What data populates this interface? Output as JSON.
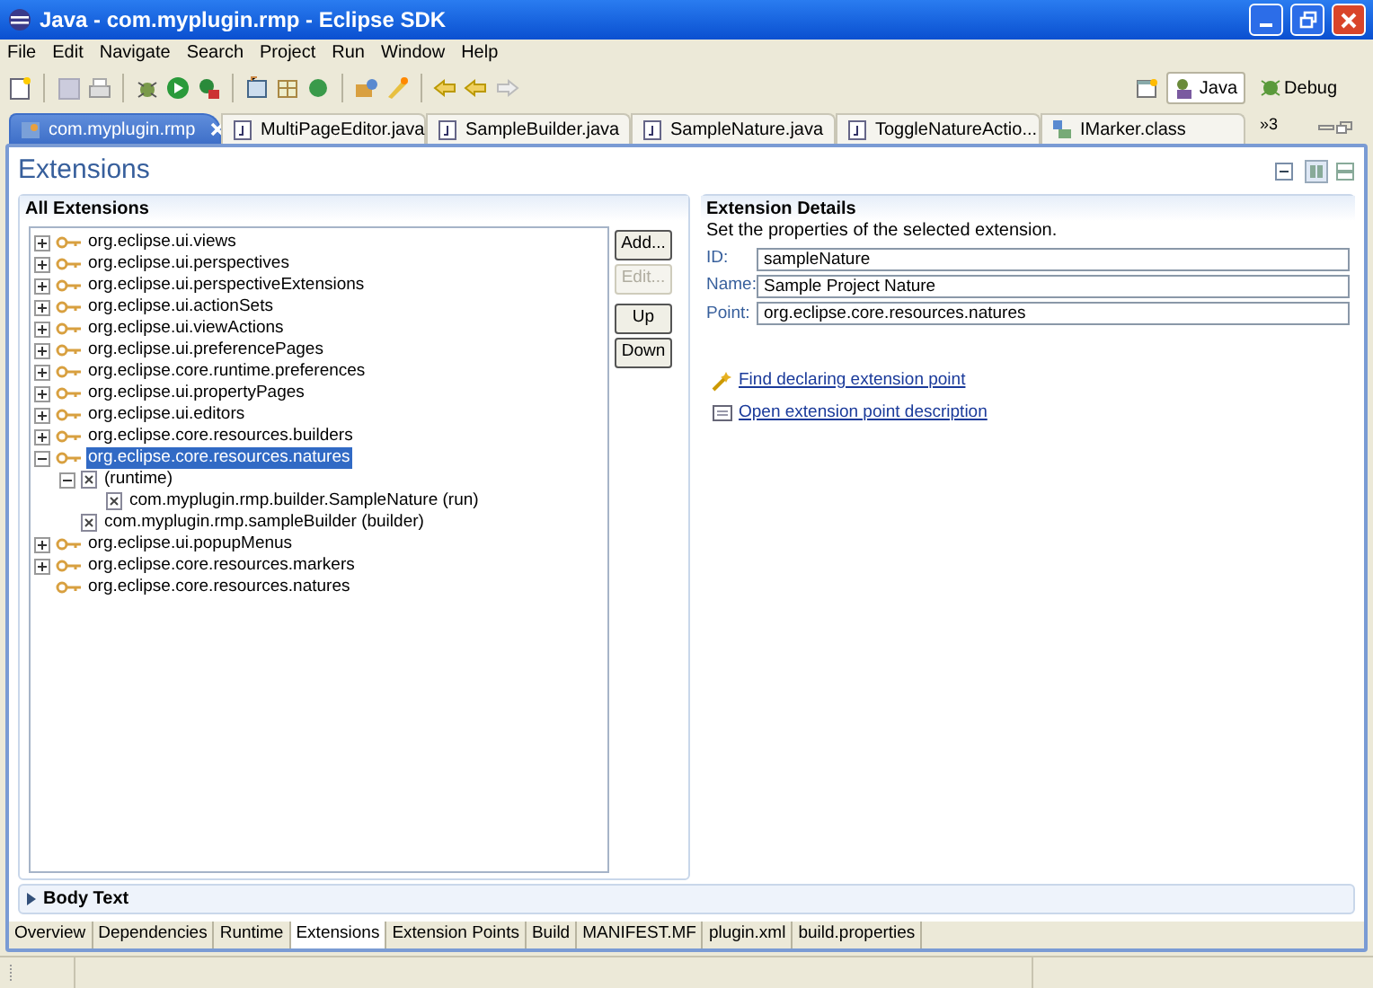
{
  "window": {
    "title": "Java - com.myplugin.rmp - Eclipse SDK"
  },
  "menu": [
    "File",
    "Edit",
    "Navigate",
    "Search",
    "Project",
    "Run",
    "Window",
    "Help"
  ],
  "perspectives": [
    {
      "label": "Java",
      "selected": true
    },
    {
      "label": "Debug",
      "selected": false
    }
  ],
  "editor_tabs": [
    {
      "label": "com.myplugin.rmp",
      "kind": "plugin",
      "selected": true
    },
    {
      "label": "MultiPageEditor.java",
      "kind": "java",
      "selected": false
    },
    {
      "label": "SampleBuilder.java",
      "kind": "java",
      "selected": false
    },
    {
      "label": "SampleNature.java",
      "kind": "java",
      "selected": false
    },
    {
      "label": "ToggleNatureActio...",
      "kind": "java",
      "selected": false
    },
    {
      "label": "IMarker.class",
      "kind": "class",
      "selected": false
    }
  ],
  "overflow_tabs": "»3",
  "page_title": "Extensions",
  "all_extensions": {
    "title": "All Extensions",
    "tree": [
      {
        "label": "org.eclipse.ui.views",
        "kind": "extension",
        "expanded": false,
        "selected": false
      },
      {
        "label": "org.eclipse.ui.perspectives",
        "kind": "extension",
        "expanded": false,
        "selected": false
      },
      {
        "label": "org.eclipse.ui.perspectiveExtensions",
        "kind": "extension",
        "expanded": false,
        "selected": false
      },
      {
        "label": "org.eclipse.ui.actionSets",
        "kind": "extension",
        "expanded": false,
        "selected": false
      },
      {
        "label": "org.eclipse.ui.viewActions",
        "kind": "extension",
        "expanded": false,
        "selected": false
      },
      {
        "label": "org.eclipse.ui.preferencePages",
        "kind": "extension",
        "expanded": false,
        "selected": false
      },
      {
        "label": "org.eclipse.core.runtime.preferences",
        "kind": "extension",
        "expanded": false,
        "selected": false
      },
      {
        "label": "org.eclipse.ui.propertyPages",
        "kind": "extension",
        "expanded": false,
        "selected": false
      },
      {
        "label": "org.eclipse.ui.editors",
        "kind": "extension",
        "expanded": false,
        "selected": false
      },
      {
        "label": "org.eclipse.core.resources.builders",
        "kind": "extension",
        "expanded": false,
        "selected": false
      },
      {
        "label": "org.eclipse.core.resources.natures",
        "kind": "extension",
        "expanded": true,
        "selected": true,
        "children": [
          {
            "label": "(runtime)",
            "kind": "element",
            "expanded": true,
            "selected": false,
            "children": [
              {
                "label": "com.myplugin.rmp.builder.SampleNature (run)",
                "kind": "element",
                "selected": false
              }
            ]
          },
          {
            "label": "com.myplugin.rmp.sampleBuilder (builder)",
            "kind": "element",
            "selected": false
          }
        ]
      },
      {
        "label": "org.eclipse.ui.popupMenus",
        "kind": "extension",
        "expanded": false,
        "selected": false
      },
      {
        "label": "org.eclipse.core.resources.markers",
        "kind": "extension",
        "expanded": false,
        "selected": false
      },
      {
        "label": "org.eclipse.core.resources.natures",
        "kind": "extension",
        "selected": false
      }
    ],
    "buttons": [
      {
        "label": "Add...",
        "disabled": false
      },
      {
        "label": "Edit...",
        "disabled": true
      },
      {
        "label": "Up",
        "disabled": false
      },
      {
        "label": "Down",
        "disabled": false
      }
    ]
  },
  "extension_details": {
    "title": "Extension Details",
    "description": "Set the properties of the selected extension.",
    "fields": [
      {
        "label": "ID:",
        "value": "sampleNature"
      },
      {
        "label": "Name:",
        "value": "Sample Project Nature"
      },
      {
        "label": "Point:",
        "value": "org.eclipse.core.resources.natures"
      }
    ],
    "links": [
      {
        "label": "Find declaring extension point",
        "kind": "find"
      },
      {
        "label": "Open extension point description",
        "kind": "open"
      }
    ]
  },
  "body_text": {
    "title": "Body Text",
    "expanded": false
  },
  "page_tabs": [
    {
      "label": "Overview",
      "selected": false
    },
    {
      "label": "Dependencies",
      "selected": false
    },
    {
      "label": "Runtime",
      "selected": false
    },
    {
      "label": "Extensions",
      "selected": true
    },
    {
      "label": "Extension Points",
      "selected": false
    },
    {
      "label": "Build",
      "selected": false
    },
    {
      "label": "MANIFEST.MF",
      "selected": false
    },
    {
      "label": "plugin.xml",
      "selected": false
    },
    {
      "label": "build.properties",
      "selected": false
    }
  ]
}
